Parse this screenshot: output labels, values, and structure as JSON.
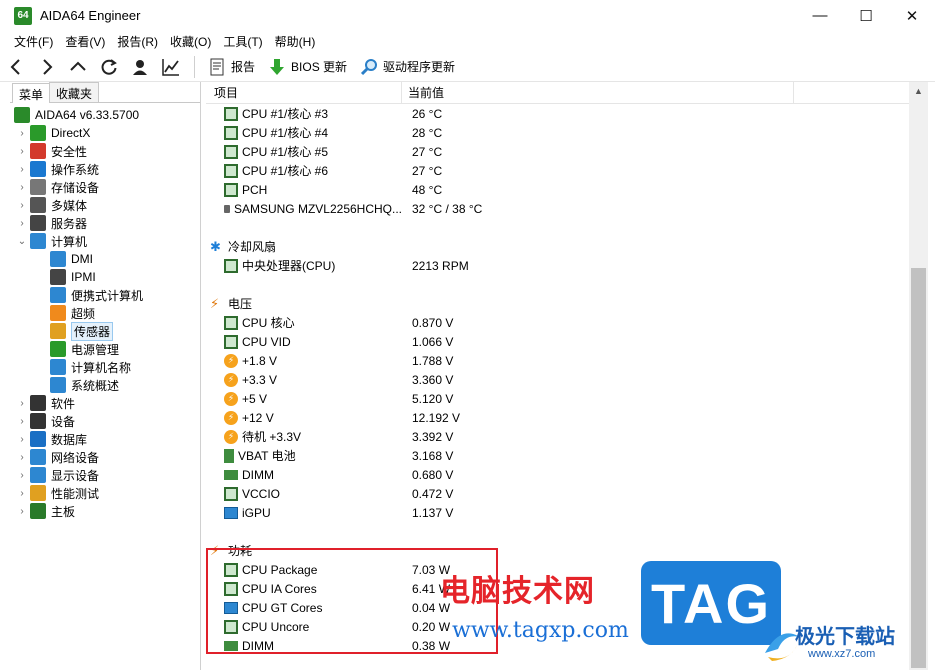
{
  "window": {
    "app_icon_text": "64",
    "title": "AIDA64 Engineer",
    "minimize": "—",
    "maximize": "☐",
    "close": "✕"
  },
  "menu": [
    "文件(F)",
    "查看(V)",
    "报告(R)",
    "收藏(O)",
    "工具(T)",
    "帮助(H)"
  ],
  "toolbar": {
    "report": "报告",
    "bios_update": "BIOS 更新",
    "driver_update": "驱动程序更新"
  },
  "left": {
    "tabs": [
      "菜单",
      "收藏夹"
    ],
    "root": "AIDA64 v6.33.5700",
    "items": [
      {
        "label": "DirectX",
        "icon": "xbox-icon",
        "color": "#2a9a2a"
      },
      {
        "label": "安全性",
        "icon": "shield-icon",
        "color": "#d33a2c"
      },
      {
        "label": "操作系统",
        "icon": "windows-icon",
        "color": "#1a78d0"
      },
      {
        "label": "存储设备",
        "icon": "disk-icon",
        "color": "#777777"
      },
      {
        "label": "多媒体",
        "icon": "speaker-icon",
        "color": "#555555"
      },
      {
        "label": "服务器",
        "icon": "server-icon",
        "color": "#444444"
      },
      {
        "label": "计算机",
        "icon": "computer-icon",
        "color": "#2d87d1"
      }
    ],
    "computer_children": [
      {
        "label": "DMI",
        "icon": "monitor-icon",
        "color": "#2d87d1"
      },
      {
        "label": "IPMI",
        "icon": "server-icon",
        "color": "#444444"
      },
      {
        "label": "便携式计算机",
        "icon": "laptop-icon",
        "color": "#2d87d1"
      },
      {
        "label": "超频",
        "icon": "flame-icon",
        "color": "#f08a1c"
      },
      {
        "label": "传感器",
        "icon": "gauge-icon",
        "color": "#e0a020"
      },
      {
        "label": "电源管理",
        "icon": "battery-icon",
        "color": "#2a9a2a"
      },
      {
        "label": "计算机名称",
        "icon": "monitor-icon",
        "color": "#2d87d1"
      },
      {
        "label": "系统概述",
        "icon": "monitor-icon",
        "color": "#2d87d1"
      }
    ],
    "items_after": [
      {
        "label": "软件",
        "icon": "disc-icon",
        "color": "#333333"
      },
      {
        "label": "设备",
        "icon": "device-icon",
        "color": "#333333"
      },
      {
        "label": "数据库",
        "icon": "database-icon",
        "color": "#1a6fc4"
      },
      {
        "label": "网络设备",
        "icon": "network-icon",
        "color": "#2d87d1"
      },
      {
        "label": "显示设备",
        "icon": "display-icon",
        "color": "#2d87d1"
      },
      {
        "label": "性能测试",
        "icon": "benchmark-icon",
        "color": "#e0a020"
      },
      {
        "label": "主板",
        "icon": "motherboard-icon",
        "color": "#2a7a2a"
      }
    ]
  },
  "columns": {
    "item": "项目",
    "value": "当前值"
  },
  "temps": [
    {
      "name": "CPU #1/核心 #3",
      "value": "26 °C"
    },
    {
      "name": "CPU #1/核心 #4",
      "value": "28 °C"
    },
    {
      "name": "CPU #1/核心 #5",
      "value": "27 °C"
    },
    {
      "name": "CPU #1/核心 #6",
      "value": "27 °C"
    },
    {
      "name": "PCH",
      "value": "48 °C"
    },
    {
      "name": "SAMSUNG MZVL2256HCHQ...",
      "value": "32 °C / 38 °C"
    }
  ],
  "fans_section": "冷却风扇",
  "fans": [
    {
      "name": "中央处理器(CPU)",
      "value": "2213 RPM"
    }
  ],
  "voltage_section": "电压",
  "voltages": [
    {
      "name": "CPU 核心",
      "value": "0.870 V",
      "icon": "chip"
    },
    {
      "name": "CPU VID",
      "value": "1.066 V",
      "icon": "chip"
    },
    {
      "name": "+1.8 V",
      "value": "1.788 V",
      "icon": "bolt"
    },
    {
      "name": "+3.3 V",
      "value": "3.360 V",
      "icon": "bolt"
    },
    {
      "name": "+5 V",
      "value": "5.120 V",
      "icon": "bolt"
    },
    {
      "name": "+12 V",
      "value": "12.192 V",
      "icon": "bolt"
    },
    {
      "name": "待机 +3.3V",
      "value": "3.392 V",
      "icon": "bolt"
    },
    {
      "name": "VBAT 电池",
      "value": "3.168 V",
      "icon": "battery"
    },
    {
      "name": "DIMM",
      "value": "0.680 V",
      "icon": "ram"
    },
    {
      "name": "VCCIO",
      "value": "0.472 V",
      "icon": "chip"
    },
    {
      "name": "iGPU",
      "value": "1.137 V",
      "icon": "monitor"
    }
  ],
  "power_section": "功耗",
  "power": [
    {
      "name": "CPU Package",
      "value": "7.03 W",
      "icon": "chip"
    },
    {
      "name": "CPU IA Cores",
      "value": "6.41 W",
      "icon": "chip"
    },
    {
      "name": "CPU GT Cores",
      "value": "0.04 W",
      "icon": "monitor"
    },
    {
      "name": "CPU Uncore",
      "value": "0.20 W",
      "icon": "chip"
    },
    {
      "name": "DIMM",
      "value": "0.38 W",
      "icon": "ram"
    }
  ],
  "watermark": {
    "cn": "电脑技术网",
    "url": "www.tagxp.com",
    "tag": "TAG",
    "logo_text": "极光下载站",
    "logo_url": "www.xz7.com"
  },
  "colors": {
    "highlight": "#e0202a",
    "selection": "#e5f1fb",
    "accent": "#1e7fd8"
  }
}
